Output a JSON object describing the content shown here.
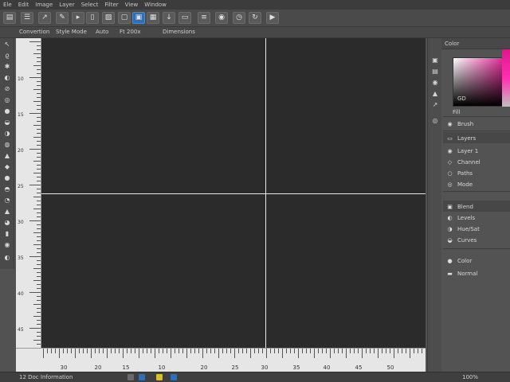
{
  "menubar": {
    "items": [
      "Ele",
      "Edit",
      "Image",
      "Layer",
      "Select",
      "Filter",
      "View",
      "Window"
    ]
  },
  "toolbar": {
    "buttons": [
      {
        "name": "new-icon",
        "glyph": "▤"
      },
      {
        "name": "menu-icon",
        "glyph": "☰"
      },
      {
        "name": "move-icon",
        "glyph": "↗"
      },
      {
        "name": "brush-icon",
        "glyph": "✎"
      },
      {
        "name": "chat-icon",
        "glyph": "▸"
      },
      {
        "name": "doc-icon",
        "glyph": "▯"
      },
      {
        "name": "image-icon",
        "glyph": "▨"
      },
      {
        "name": "frame-icon",
        "glyph": "▢"
      },
      {
        "name": "layers-icon",
        "glyph": "▣"
      },
      {
        "name": "grid-icon",
        "glyph": "▦"
      },
      {
        "name": "pin-icon",
        "glyph": "↓"
      },
      {
        "name": "screen-icon",
        "glyph": "▭"
      },
      {
        "name": "align-icon",
        "glyph": "≡"
      },
      {
        "name": "eye-icon",
        "glyph": "◉"
      },
      {
        "name": "clock-icon",
        "glyph": "◷"
      },
      {
        "name": "sync-icon",
        "glyph": "↻"
      },
      {
        "name": "play-icon",
        "glyph": "▶"
      }
    ]
  },
  "optbar": {
    "items": [
      "Convertion",
      "Style Mode",
      "Auto",
      "Ft 200x",
      "Dimensions"
    ]
  },
  "tools": [
    {
      "name": "move-tool-icon",
      "glyph": "↖"
    },
    {
      "name": "lasso-tool-icon",
      "glyph": "ϱ"
    },
    {
      "name": "wand-tool-icon",
      "glyph": "✱"
    },
    {
      "name": "crop-tool-icon",
      "glyph": "◐"
    },
    {
      "name": "eyedropper-tool-icon",
      "glyph": "⊘"
    },
    {
      "name": "heal-tool-icon",
      "glyph": "◎"
    },
    {
      "name": "brush-tool-icon",
      "glyph": "●"
    },
    {
      "name": "stamp-tool-icon",
      "glyph": "◒"
    },
    {
      "name": "history-tool-icon",
      "glyph": "◑"
    },
    {
      "name": "eraser-tool-icon",
      "glyph": "◍"
    },
    {
      "name": "gradient-tool-icon",
      "glyph": "▲"
    },
    {
      "name": "blur-tool-icon",
      "glyph": "◆"
    },
    {
      "name": "dodge-tool-icon",
      "glyph": "●"
    },
    {
      "name": "pen-tool-icon",
      "glyph": "◓"
    },
    {
      "name": "type-tool-icon",
      "glyph": "◔"
    },
    {
      "name": "path-tool-icon",
      "glyph": "▲"
    },
    {
      "name": "shape-tool-icon",
      "glyph": "◕"
    },
    {
      "name": "hand-tool-icon",
      "glyph": "▮"
    },
    {
      "name": "zoom-tool-icon",
      "glyph": "◉"
    },
    {
      "name": "swatch-tool-icon",
      "glyph": "◐"
    }
  ],
  "ruler": {
    "vertical_labels": [
      "10",
      "15",
      "20",
      "25",
      "30",
      "35",
      "40",
      "45"
    ],
    "horizontal_labels": [
      "30",
      "20",
      "15",
      "10",
      "20",
      "25",
      "30",
      "35",
      "40",
      "45",
      "50"
    ]
  },
  "rstrip": {
    "icons": [
      "▣",
      "▤",
      "◉",
      "▲",
      "↗",
      "◎",
      "▸",
      "◐"
    ]
  },
  "panels": {
    "color_tab": "Color",
    "picker_value": "GD",
    "fg_label": "Fill",
    "brush_label": "Brush",
    "layers_tab": "Layers",
    "layer_rows": [
      "Layer 1",
      "Channel",
      "Paths",
      "Mode"
    ],
    "adjust_rows": [
      "Blend",
      "Levels",
      "Hue/Sat",
      "Curves",
      "Color",
      "Normal"
    ]
  },
  "statusbar": {
    "doc_info": "12 Doc Information",
    "zoom": "100%"
  }
}
